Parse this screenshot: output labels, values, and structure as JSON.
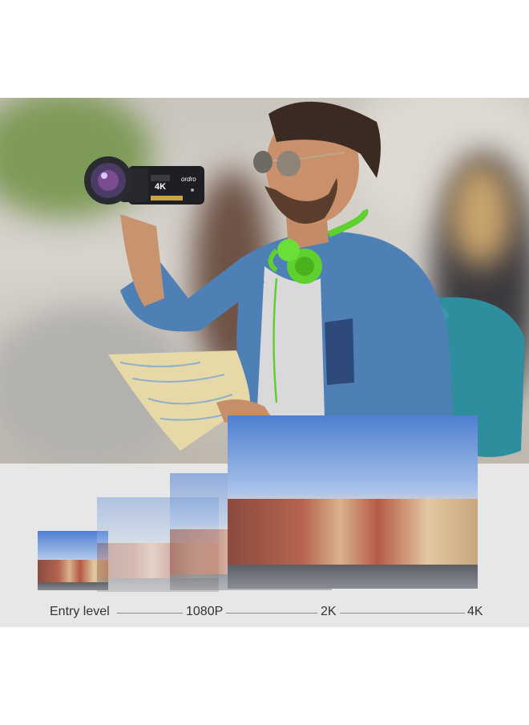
{
  "camera_brand": "ordro",
  "camera_badge": "4K",
  "levels": [
    {
      "label": "Entry level"
    },
    {
      "label": "1080P"
    },
    {
      "label": "2K"
    },
    {
      "label": "4K"
    }
  ],
  "colors": {
    "panel_bg": "#e7e7e7",
    "headphone_green": "#5fd12f",
    "jacket_blue": "#4e7fb5",
    "backpack_teal": "#2f8e9e"
  }
}
